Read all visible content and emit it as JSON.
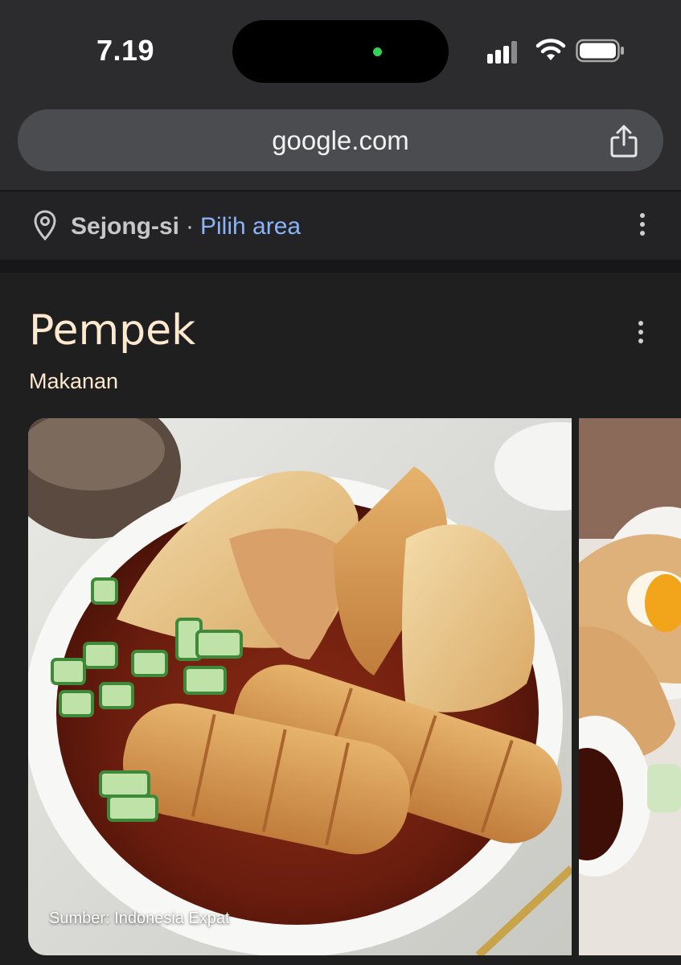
{
  "status_bar": {
    "time": "7.19",
    "icons": [
      "camera-indicator-dot",
      "cellular-signal-icon",
      "wifi-icon",
      "battery-icon"
    ],
    "indicator_color": "#32d25a"
  },
  "browser": {
    "url": "google.com",
    "share_icon": "share-icon"
  },
  "location": {
    "city": "Sejong-si",
    "separator": "·",
    "change_link": "Pilih area",
    "link_color": "#8ab4f8"
  },
  "knowledge_panel": {
    "title": "Pempek",
    "subtitle": "Makanan",
    "accent_color": "#fde8d0",
    "images": [
      {
        "caption": "Sumber: Indonesia Expat"
      },
      {
        "caption": ""
      }
    ]
  }
}
